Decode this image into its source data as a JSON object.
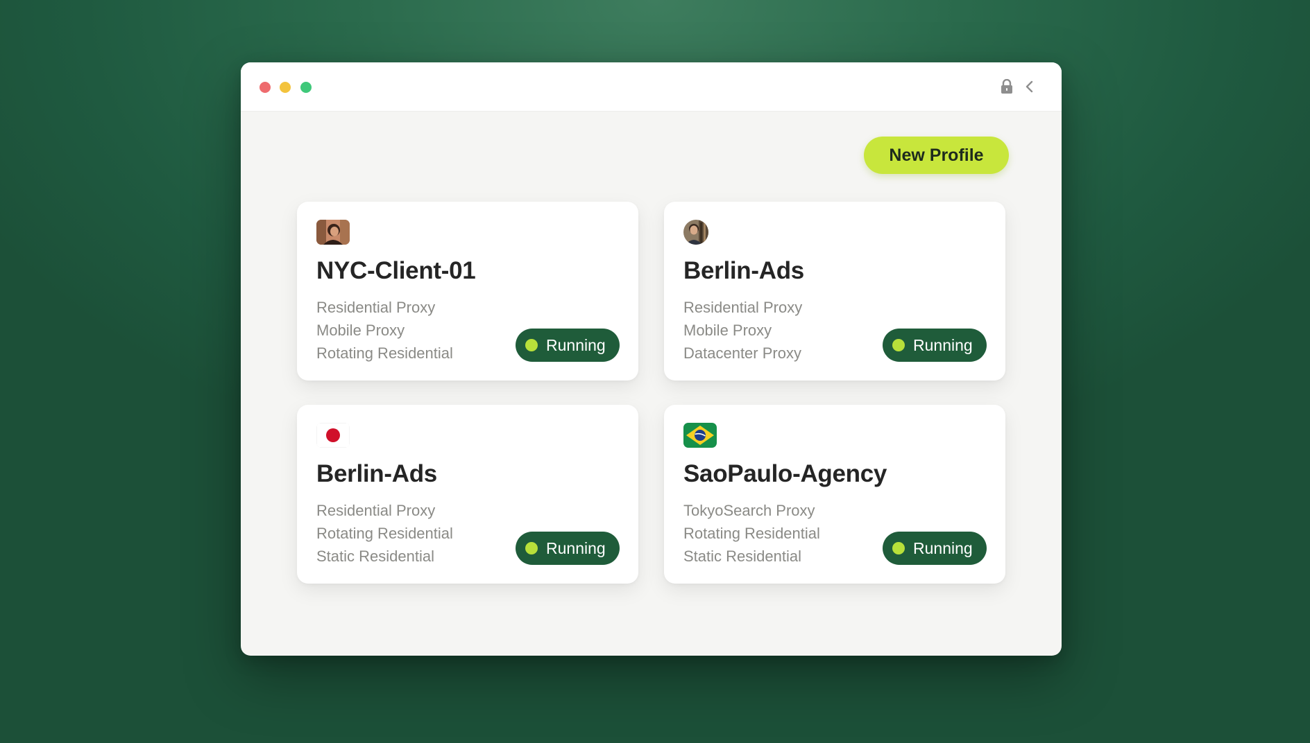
{
  "toolbar": {
    "new_profile_label": "New Profile"
  },
  "colors": {
    "accent": "#c8e63c",
    "status_bg": "#1f5c3a",
    "status_dot": "#b8e03a",
    "background": "#2a6a4c"
  },
  "profiles": [
    {
      "name": "NYC-Client-01",
      "icon": "avatar-woman",
      "proxies": [
        "Residential Proxy",
        "Mobile Proxy",
        "Rotating Residential"
      ],
      "status": "Running"
    },
    {
      "name": "Berlin-Ads",
      "icon": "avatar-man",
      "proxies": [
        "Residential Proxy",
        "Mobile Proxy",
        "Datacenter Proxy"
      ],
      "status": "Running"
    },
    {
      "name": "Berlin-Ads",
      "icon": "japan-flag",
      "proxies": [
        "Residential Proxy",
        "Rotating Residential",
        "Static Residential"
      ],
      "status": "Running"
    },
    {
      "name": "SaoPaulo-Agency",
      "icon": "brazil-flag",
      "proxies": [
        "TokyoSearch Proxy",
        "Rotating Residential",
        "Static Residential"
      ],
      "status": "Running"
    }
  ]
}
